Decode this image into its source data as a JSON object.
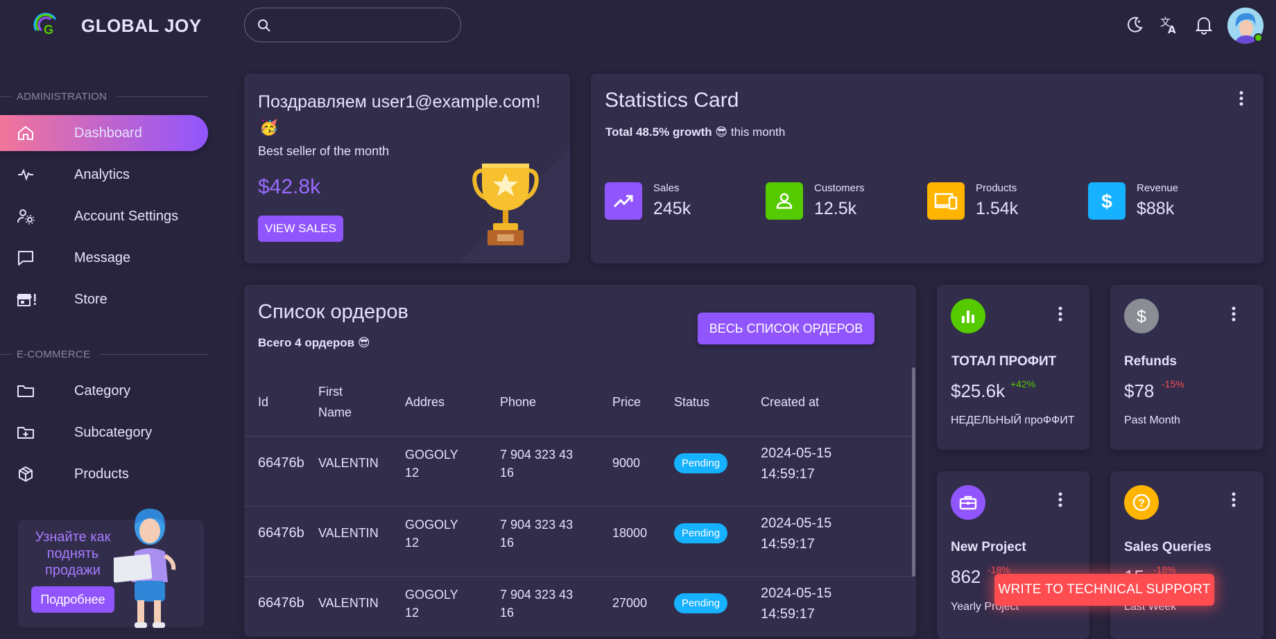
{
  "app": {
    "brand": "GLOBAL JOY"
  },
  "search": {
    "placeholder": ""
  },
  "header_icons": [
    "moon-icon",
    "translate-icon",
    "bell-icon",
    "avatar"
  ],
  "sidebar": {
    "sections": [
      {
        "title": "ADMINISTRATION"
      },
      {
        "title": "E-COMMERCE"
      }
    ],
    "admin_items": [
      {
        "label": "Dashboard",
        "icon": "home-icon",
        "active": true
      },
      {
        "label": "Analytics",
        "icon": "pulse-icon"
      },
      {
        "label": "Account Settings",
        "icon": "user-settings-icon"
      },
      {
        "label": "Message",
        "icon": "message-icon"
      },
      {
        "label": "Store",
        "icon": "store-icon"
      }
    ],
    "ecommerce_items": [
      {
        "label": "Category",
        "icon": "folder-icon"
      },
      {
        "label": "Subcategory",
        "icon": "folder-plus-icon"
      },
      {
        "label": "Products",
        "icon": "cube-icon"
      }
    ],
    "promo": {
      "text": "Узнайте как поднять продажи",
      "button": "Подробнее"
    }
  },
  "congrats": {
    "title": "Поздравляем user1@example.com!",
    "emoji": "🥳",
    "subtitle": "Best seller of the month",
    "amount": "$42.8k",
    "button": "VIEW SALES"
  },
  "statistics": {
    "title": "Statistics Card",
    "growth_bold": "Total 48.5% growth",
    "emoji": "😎",
    "growth_rest": "this month",
    "items": [
      {
        "label": "Sales",
        "value": "245k",
        "icon": "trending-up-icon",
        "color": "#9155fd"
      },
      {
        "label": "Customers",
        "value": "12.5k",
        "icon": "account-icon",
        "color": "#56ca00"
      },
      {
        "label": "Products",
        "value": "1.54k",
        "icon": "devices-icon",
        "color": "#ffb400"
      },
      {
        "label": "Revenue",
        "value": "$88k",
        "icon": "dollar-icon",
        "color": "#16b1ff"
      }
    ]
  },
  "orders": {
    "title": "Список ордеров",
    "subtitle": "Всего 4 ордеров",
    "emoji": "😎",
    "button": "ВЕСЬ СПИСОК ОРДЕРОВ",
    "columns": [
      "Id",
      "First Name",
      "Addres",
      "Phone",
      "Price",
      "Status",
      "Created at"
    ],
    "rows": [
      {
        "id": "66476b",
        "first_name": "VALENTIN",
        "address": "GOGOLY 12",
        "phone": "7 904 323 43 16",
        "price": "9000",
        "status": "Pending",
        "created_at": "2024-05-15 14:59:17"
      },
      {
        "id": "66476b",
        "first_name": "VALENTIN",
        "address": "GOGOLY 12",
        "phone": "7 904 323 43 16",
        "price": "18000",
        "status": "Pending",
        "created_at": "2024-05-15 14:59:17"
      },
      {
        "id": "66476b",
        "first_name": "VALENTIN",
        "address": "GOGOLY 12",
        "phone": "7 904 323 43 16",
        "price": "27000",
        "status": "Pending",
        "created_at": "2024-05-15 14:59:17"
      }
    ]
  },
  "mini_cards": [
    {
      "title": "ТОТАЛ ПРОФИТ",
      "value": "$25.6k",
      "change": "+42%",
      "change_color": "#56ca00",
      "subtitle": "НЕДЕЛЬНЫЙ проФФИТ",
      "icon": "chart-bar-icon",
      "color": "#56ca00"
    },
    {
      "title": "Refunds",
      "value": "$78",
      "change": "-15%",
      "change_color": "#ff4c51",
      "subtitle": "Past Month",
      "icon": "dollar-icon",
      "color": "#8a8d93"
    },
    {
      "title": "New Project",
      "value": "862",
      "change": "-18%",
      "change_color": "#ff4c51",
      "subtitle": "Yearly Project",
      "icon": "briefcase-icon",
      "color": "#9155fd"
    },
    {
      "title": "Sales Queries",
      "value": "15",
      "change": "-18%",
      "change_color": "#ff4c51",
      "subtitle": "Last Week",
      "icon": "help-circle-icon",
      "color": "#ffb400"
    }
  ],
  "support_button": "WRITE TO TECHNICAL SUPPORT"
}
